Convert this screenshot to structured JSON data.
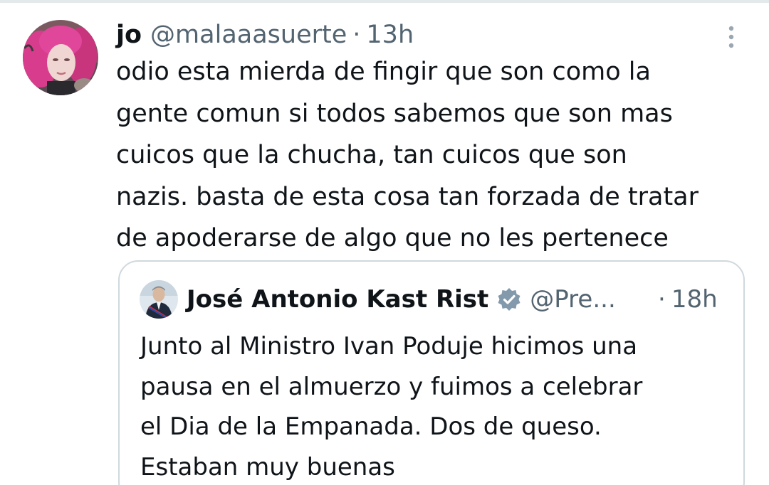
{
  "tweet": {
    "display_name": "jo",
    "handle": "@malaaasuerte",
    "separator": "·",
    "time": "13h",
    "text_lines": [
      "odio esta mierda de fingir que son como la",
      "gente comun si todos sabemos que son mas",
      "cuicos que la chucha, tan cuicos que son",
      "nazis. basta de esta cosa tan forzada de tratar",
      "de apoderarse de algo que no les pertenece"
    ],
    "icons": {
      "avatar": "profile-photo",
      "menu": "more-vertical-icon"
    }
  },
  "quoted_tweet": {
    "display_name": "José Antonio Kast Rist",
    "handle": "@Pre...",
    "separator": "·",
    "time": "18h",
    "text_lines": [
      "Junto al Ministro Ivan Poduje hicimos una",
      "pausa en el almuerzo y fuimos a celebrar",
      "el Dia de la Empanada. Dos de queso.",
      "Estaban muy buenas"
    ],
    "icons": {
      "avatar": "profile-photo",
      "verified": "verified-badge-icon"
    }
  },
  "colors": {
    "text_primary": "#0f1419",
    "text_secondary": "#536471",
    "border": "#cfd9de",
    "verified_badge": "#829aab"
  }
}
